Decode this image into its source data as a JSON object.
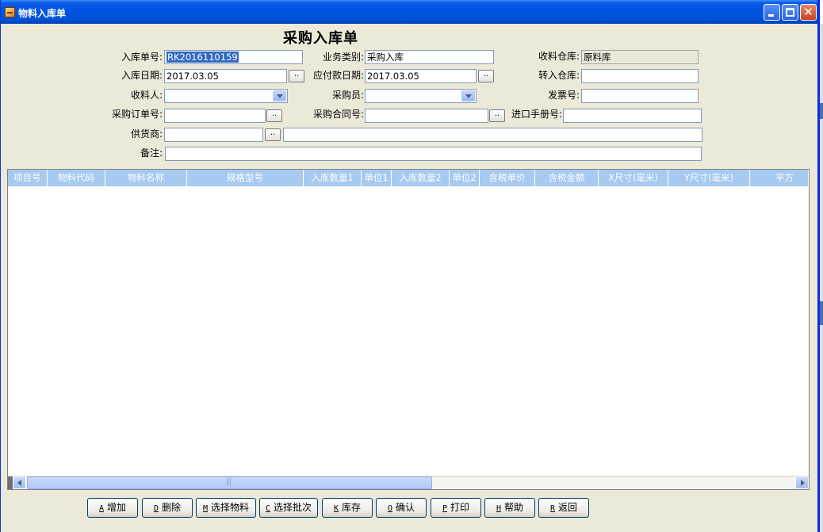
{
  "window": {
    "title": "物料入库单"
  },
  "form": {
    "title": "采购入库单",
    "receipt_no": {
      "label": "入库单号:",
      "value": "RK2016110159"
    },
    "business_type": {
      "label": "业务类别:",
      "value": "采购入库"
    },
    "receive_warehouse": {
      "label": "收料仓库:",
      "value": "原料库"
    },
    "receipt_date": {
      "label": "入库日期:",
      "value": "2017.03.05",
      "button": ".."
    },
    "payment_date": {
      "label": "应付款日期:",
      "value": "2017.03.05",
      "button": ".."
    },
    "transfer_warehouse": {
      "label": "转入仓库:",
      "value": ""
    },
    "receiver": {
      "label": "收料人:",
      "value": ""
    },
    "purchaser": {
      "label": "采购员:",
      "value": ""
    },
    "invoice_no": {
      "label": "发票号:",
      "value": ""
    },
    "po_no": {
      "label": "采购订单号:",
      "value": "",
      "button": ".."
    },
    "contract_no": {
      "label": "采购合同号:",
      "value": "",
      "button": ".."
    },
    "import_manual_no": {
      "label": "进口手册号:",
      "value": ""
    },
    "supplier": {
      "label": "供货商:",
      "value": "",
      "button": "..",
      "name_value": ""
    },
    "remarks": {
      "label": "备注:",
      "value": ""
    }
  },
  "grid": {
    "columns": [
      "项目号",
      "物料代码",
      "物料名称",
      "规格型号",
      "入库数量1",
      "单位1",
      "入库数量2",
      "单位2",
      "含税单价",
      "含税金额",
      "X尺寸(毫米)",
      "Y尺寸(毫米)",
      "平方"
    ],
    "rows": []
  },
  "buttons": [
    {
      "key": "A",
      "label": "增加"
    },
    {
      "key": "D",
      "label": "删除"
    },
    {
      "key": "M",
      "label": "选择物料"
    },
    {
      "key": "C",
      "label": "选择批次"
    },
    {
      "key": "K",
      "label": "库存"
    },
    {
      "key": "O",
      "label": "确认"
    },
    {
      "key": "P",
      "label": "打印"
    },
    {
      "key": "H",
      "label": "帮助"
    },
    {
      "key": "R",
      "label": "返回"
    }
  ]
}
